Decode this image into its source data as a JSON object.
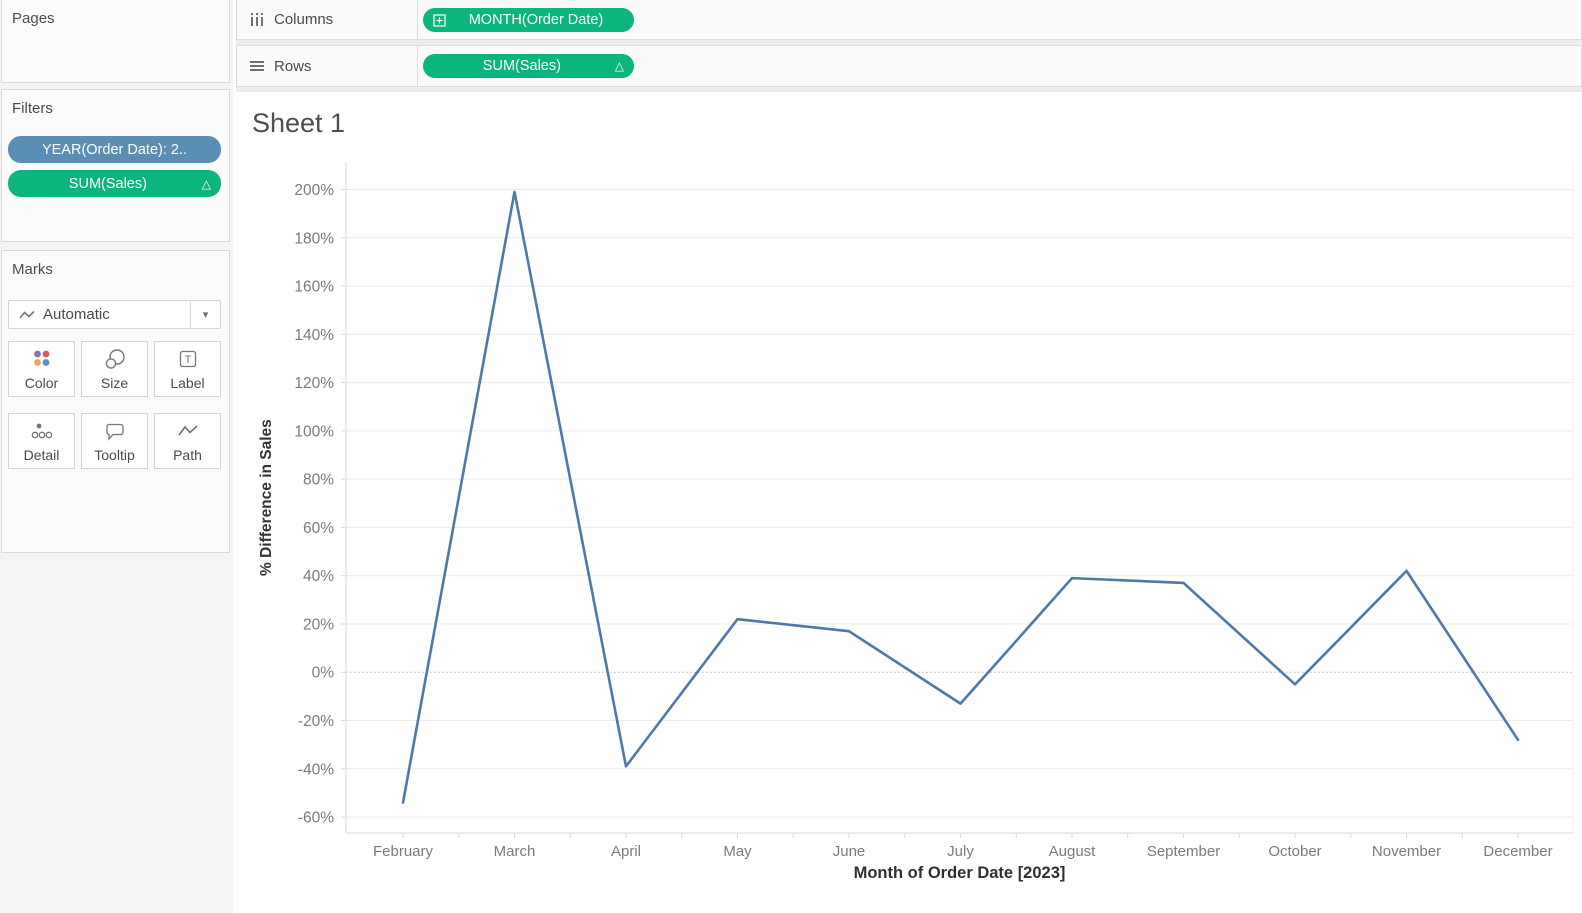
{
  "sidebar": {
    "pages_title": "Pages",
    "filters_title": "Filters",
    "filter_pills": [
      {
        "label": "YEAR(Order Date): 2..",
        "color": "#5A8EB5",
        "badge": ""
      },
      {
        "label": "SUM(Sales)",
        "color": "#0CB47E",
        "badge": "△"
      }
    ],
    "marks_title": "Marks",
    "mark_type": "Automatic",
    "mark_buttons": [
      "Color",
      "Size",
      "Label",
      "Detail",
      "Tooltip",
      "Path"
    ]
  },
  "shelves": {
    "columns_label": "Columns",
    "columns_pill": "MONTH(Order Date)",
    "rows_label": "Rows",
    "rows_pill": "SUM(Sales)",
    "rows_pill_badge": "△"
  },
  "sheet_title": "Sheet 1",
  "chart_data": {
    "type": "line",
    "title": "Sheet 1",
    "categories": [
      "February",
      "March",
      "April",
      "May",
      "June",
      "July",
      "August",
      "September",
      "October",
      "November",
      "December"
    ],
    "values": [
      -54,
      199,
      -39,
      22,
      17,
      -13,
      39,
      37,
      -5,
      42,
      -28
    ],
    "xlabel": "Month of Order Date [2023]",
    "ylabel": "% Difference in Sales",
    "ylim": [
      -66.6,
      211.4
    ],
    "yticks": {
      "min": -60,
      "max": 200,
      "step": 20,
      "format": "percent"
    },
    "grid": true,
    "zero_line": "dotted",
    "legend": "none",
    "line_color": "#4E79A7"
  },
  "colors": {
    "pill_green": "#0CB47E",
    "pill_blue": "#5A8EB5",
    "line": "#4E79A7",
    "color_dots": [
      "#8e6fa8",
      "#e0565a",
      "#f4a259",
      "#5a8ec6"
    ]
  }
}
